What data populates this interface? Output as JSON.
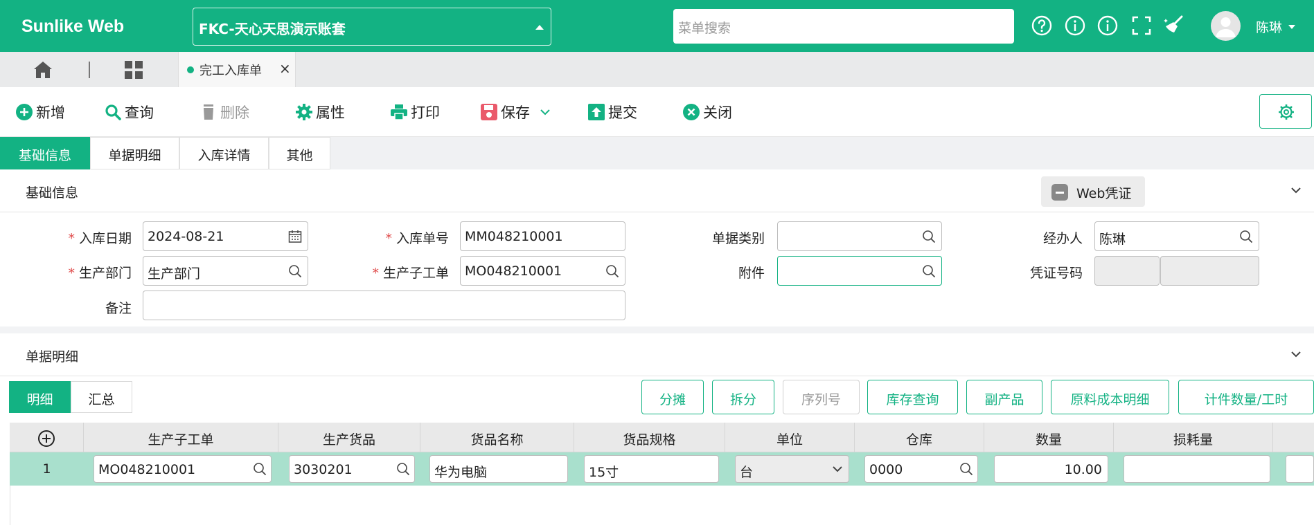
{
  "header": {
    "brand": "Sunlike Web",
    "account_set": "FKC-天心天思演示账套",
    "search_placeholder": "菜单搜索",
    "user_name": "陈琳",
    "icons": [
      "help-icon",
      "info-icon",
      "info-icon",
      "fullscreen-icon",
      "broom-icon",
      "avatar"
    ]
  },
  "tabs": {
    "open_tab": "完工入库单",
    "close": "×"
  },
  "toolbar": {
    "new": "新增",
    "query": "查询",
    "delete": "删除",
    "properties": "属性",
    "print": "打印",
    "save": "保存",
    "submit": "提交",
    "close": "关闭"
  },
  "section_tabs": [
    "基础信息",
    "单据明细",
    "入库详情",
    "其他"
  ],
  "basic": {
    "title": "基础信息",
    "web_voucher": "Web凭证",
    "required_mark": "*",
    "labels": {
      "in_date": "入库日期",
      "in_no": "入库单号",
      "doc_type": "单据类别",
      "handler": "经办人",
      "dept": "生产部门",
      "sub_order": "生产子工单",
      "attachment": "附件",
      "voucher_no": "凭证号码",
      "remark": "备注"
    },
    "values": {
      "in_date": "2024-08-21",
      "in_no": "MM048210001",
      "doc_type": "",
      "handler": "陈琳",
      "dept": "生产部门",
      "sub_order": "MO048210001",
      "attachment": "",
      "voucher_no_1": "",
      "voucher_no_2": "",
      "remark": ""
    }
  },
  "detail": {
    "title": "单据明细",
    "subtabs": [
      "明细",
      "汇总"
    ],
    "buttons": [
      "分摊",
      "拆分",
      "序列号",
      "库存查询",
      "副产品",
      "原料成本明细",
      "计件数量/工时"
    ],
    "columns": [
      "生产子工单",
      "生产货品",
      "货品名称",
      "货品规格",
      "单位",
      "仓库",
      "数量",
      "损耗量"
    ],
    "rows": [
      {
        "num": "1",
        "sub_order": "MO048210001",
        "product": "3030201",
        "name": "华为电脑",
        "spec": "15寸",
        "unit": "台",
        "warehouse": "0000",
        "qty": "10.00",
        "loss": ""
      }
    ]
  },
  "colors": {
    "primary": "#13b283",
    "row_highlight": "#a9e0cd",
    "required": "#e04a4a"
  }
}
